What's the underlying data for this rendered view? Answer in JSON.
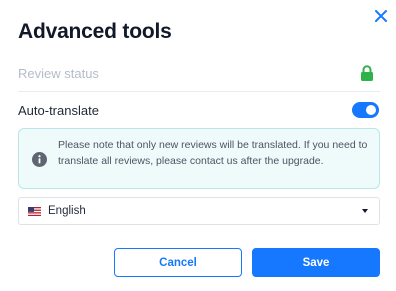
{
  "dialog": {
    "title": "Advanced tools",
    "close_icon": "close-icon"
  },
  "review_status": {
    "label": "Review status",
    "icon": "lock-icon",
    "icon_color": "#2db34a"
  },
  "auto_translate": {
    "label": "Auto-translate",
    "enabled": true,
    "toggle_color": "#1677ff"
  },
  "notice": {
    "icon": "info-icon",
    "text": "Please note that only new reviews will be translated. If you need to translate all reviews, please contact us after the upgrade."
  },
  "language_select": {
    "flag_icon": "us-flag-icon",
    "value": "English"
  },
  "buttons": {
    "cancel_label": "Cancel",
    "save_label": "Save"
  },
  "colors": {
    "accent": "#1677ff",
    "info_bg": "#effafb",
    "info_border": "#b9e6ea"
  }
}
